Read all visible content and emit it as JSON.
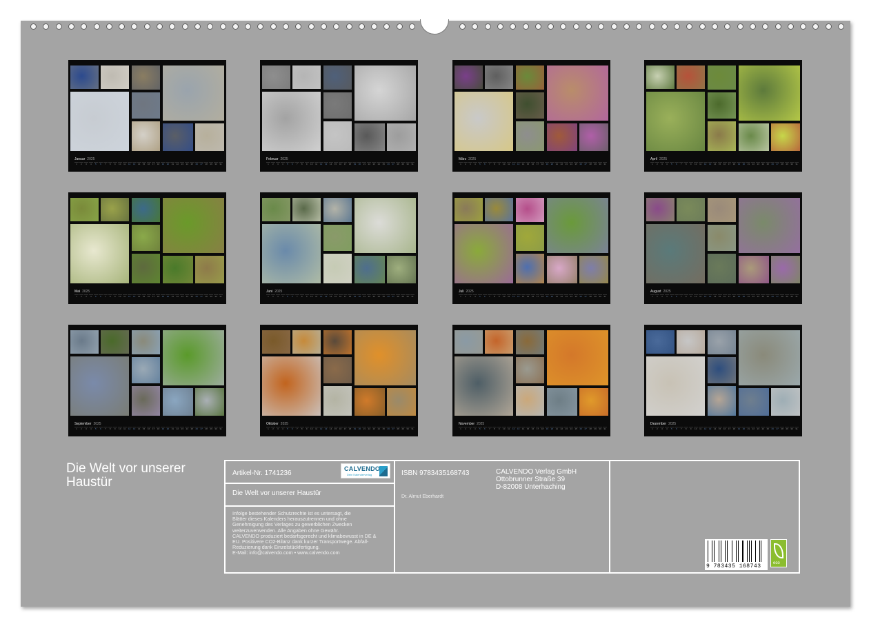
{
  "months": [
    {
      "name": "Januar",
      "year": "2025",
      "palette": [
        "#2c4a8e",
        "#bfbbb2",
        "#8a7d62",
        "#9aa4ad",
        "#c7ccd2",
        "#6f7680",
        "#d4d0c8",
        "#5a5e66",
        "#b7b09c",
        "#cfd6de",
        "#6e7b8c",
        "#a89878"
      ]
    },
    {
      "name": "Februar",
      "year": "2025",
      "palette": [
        "#8e8e8e",
        "#b5b5b5",
        "#4f607a",
        "#d5d5d5",
        "#a3a3a3",
        "#7a7a7a",
        "#c4c4c4",
        "#595959",
        "#9d9d9d",
        "#d9d9d9",
        "#6c6c6c",
        "#b9b9b9"
      ]
    },
    {
      "name": "März",
      "year": "2025",
      "palette": [
        "#7a3f8a",
        "#5f5f5f",
        "#6a8a3a",
        "#b98d6a",
        "#c9c9c9",
        "#3f4f2f",
        "#8e8e8e",
        "#a05a3a",
        "#b05fa8",
        "#d9c77a",
        "#6f5f4f",
        "#8a9a6a"
      ]
    },
    {
      "name": "April",
      "year": "2025",
      "palette": [
        "#c7d0b2",
        "#b6523a",
        "#6d8a3a",
        "#5d7a3c",
        "#9ab05a",
        "#4c6a2c",
        "#8a7a4a",
        "#6a8a4a",
        "#c6d74a",
        "#5e7d3d",
        "#7e9d5d",
        "#aec25a"
      ]
    },
    {
      "name": "Mai",
      "year": "2025",
      "palette": [
        "#7a8a3a",
        "#9aa24a",
        "#3c6a8a",
        "#6a9a2a",
        "#e8e8d0",
        "#8aa94a",
        "#5e6a3e",
        "#4a7a2a",
        "#8e7a4a",
        "#9aaa6a",
        "#6a7a3a",
        "#5e8a2e"
      ]
    },
    {
      "name": "Juni",
      "year": "2025",
      "palette": [
        "#6a8a4a",
        "#5a6a4a",
        "#b3b3a8",
        "#dcdcd8",
        "#6a8aaa",
        "#8a9a6a",
        "#c6cbb5",
        "#4e6e8e",
        "#9eae7e",
        "#bcc5a5",
        "#7e9e5e",
        "#d2d2c6"
      ]
    },
    {
      "name": "Juli",
      "year": "2025",
      "palette": [
        "#8a7a5a",
        "#9a8a3a",
        "#b54e8a",
        "#6a9a3a",
        "#8aaa3a",
        "#a0a83a",
        "#4e6fb0",
        "#d8a8c8",
        "#7e7eaa",
        "#9e5eaa",
        "#8a9a4a",
        "#c68a3a"
      ]
    },
    {
      "name": "August",
      "year": "2025",
      "palette": [
        "#8a4a8a",
        "#7a8a5a",
        "#9a8a7a",
        "#7a8a6a",
        "#5a7a7a",
        "#8a8a6a",
        "#6a7a5a",
        "#aa9a7a",
        "#9a6aaa",
        "#7a6a5a",
        "#8a9a8a",
        "#5a6a5a"
      ]
    },
    {
      "name": "September",
      "year": "2025",
      "palette": [
        "#6a7a8a",
        "#4a6a2a",
        "#8a8a7a",
        "#5a9a2a",
        "#7a8aaa",
        "#9aa9b5",
        "#6a6a5a",
        "#8aa6c0",
        "#aab0b5",
        "#7a7a6a",
        "#5a7a9a",
        "#9a8ab0"
      ]
    },
    {
      "name": "Oktober",
      "year": "2025",
      "palette": [
        "#7a5a2a",
        "#c68a3a",
        "#5a4a3a",
        "#e0902a",
        "#c2641e",
        "#8a6a4a",
        "#b4b4a4",
        "#d07a2a",
        "#9a8a6a",
        "#ccd2d8",
        "#6a5a4a",
        "#c6c6c0"
      ]
    },
    {
      "name": "November",
      "year": "2025",
      "palette": [
        "#8a9aa5",
        "#c4642a",
        "#8a6a3a",
        "#d4782a",
        "#4e5e66",
        "#9a9a90",
        "#cba87a",
        "#6e7e86",
        "#e09a2a",
        "#c4b4a0",
        "#8a6a4a",
        "#b2bac0"
      ]
    },
    {
      "name": "Dezember",
      "year": "2025",
      "palette": [
        "#4a6a9a",
        "#c6c6c6",
        "#9aa2aa",
        "#8a8a7a",
        "#c8c2b5",
        "#2e4e7e",
        "#b5a595",
        "#6e7e8e",
        "#9eaeb5",
        "#d4d4d4",
        "#7a7a7a",
        "#3e6e9e"
      ]
    }
  ],
  "cover": {
    "title": "Die Welt vor unserer Haustür"
  },
  "info": {
    "article": "Artikel-Nr. 1741236",
    "logo_name": "CALVENDO",
    "logo_sub": "Dein Kalenderverlag",
    "subtitle": "Die Welt vor unserer Haustür",
    "legal_lines": [
      "Infolge bestehender Schutzrechte ist es untersagt, die",
      "Blätter dieses Kalenders herauszutrennen und ohne",
      "Genehmigung des Verlages zu gewerblichen Zwecken",
      "weiterzuverwenden. Alle Angaben ohne Gewähr.",
      "CALVENDO produziert bedarfsgerecht und klimabewusst in DE &",
      "EU. Positivere CO2-Bilanz dank kurzer Transportwege. Abfall-",
      "Reduzierung dank Einzelstückfertigung.",
      "E-Mail: info@calvendo.com • www.calvendo.com"
    ],
    "isbn": "ISBN 9783435168743",
    "author": "Dr. Almut Eberhardt",
    "publisher": [
      "CALVENDO Verlag GmbH",
      "Ottobrunner Straße 39",
      "D-82008 Unterhaching"
    ],
    "barcode_number": "9 783435 168743",
    "eco_label": "eco",
    "colors": {
      "board": "#a4a4a4",
      "eco_green": "#8bbd2f",
      "logo_blue": "#1d6b8f"
    }
  }
}
